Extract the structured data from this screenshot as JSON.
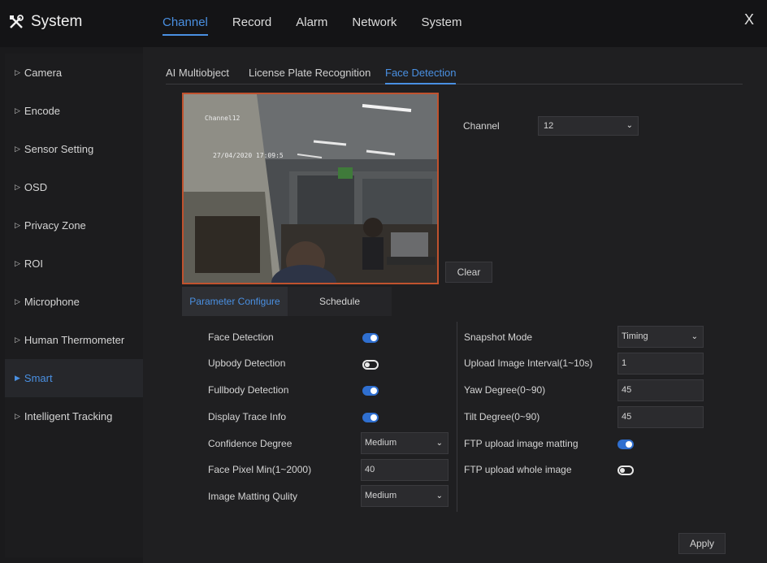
{
  "app": {
    "title": "System",
    "logo_icon": "tools-icon"
  },
  "top_nav": {
    "items": [
      "Channel",
      "Record",
      "Alarm",
      "Network",
      "System"
    ],
    "active": "Channel"
  },
  "close_label": "X",
  "sidebar": {
    "items": [
      "Camera",
      "Encode",
      "Sensor Setting",
      "OSD",
      "Privacy Zone",
      "ROI",
      "Microphone",
      "Human Thermometer",
      "Smart",
      "Intelligent Tracking"
    ],
    "active": "Smart"
  },
  "subtabs": {
    "items": [
      "AI Multiobject",
      "License Plate Recognition",
      "Face Detection"
    ],
    "active": "Face Detection"
  },
  "preview": {
    "osd_title": "Channel12",
    "osd_time": "27/04/2020 17:09:5"
  },
  "channel": {
    "label": "Channel",
    "value": "12"
  },
  "clear_label": "Clear",
  "config_tabs": {
    "items": [
      "Parameter Configure",
      "Schedule"
    ],
    "active": "Parameter Configure"
  },
  "left_params": {
    "face_detection": {
      "label": "Face Detection",
      "enabled": true
    },
    "upbody_detection": {
      "label": "Upbody Detection",
      "enabled": false
    },
    "fullbody_detection": {
      "label": "Fullbody Detection",
      "enabled": true
    },
    "display_trace_info": {
      "label": "Display Trace Info",
      "enabled": true
    },
    "confidence_degree": {
      "label": "Confidence Degree",
      "value": "Medium"
    },
    "face_pixel_min": {
      "label": "Face Pixel Min(1~2000)",
      "value": "40"
    },
    "image_matting_quality": {
      "label": "Image Matting Qulity",
      "value": "Medium"
    }
  },
  "right_params": {
    "snapshot_mode": {
      "label": "Snapshot Mode",
      "value": "Timing"
    },
    "upload_interval": {
      "label": "Upload Image Interval(1~10s)",
      "value": "1"
    },
    "yaw_degree": {
      "label": "Yaw Degree(0~90)",
      "value": "45"
    },
    "tilt_degree": {
      "label": "Tilt Degree(0~90)",
      "value": "45"
    },
    "ftp_image_matting": {
      "label": "FTP upload image matting",
      "enabled": true
    },
    "ftp_whole_image": {
      "label": "FTP upload whole image",
      "enabled": false
    }
  },
  "apply_label": "Apply",
  "colors": {
    "accent": "#4a90e2",
    "toggle_on": "#2f6fd0",
    "preview_border": "#c0522e",
    "background": "#1a1a1c"
  }
}
